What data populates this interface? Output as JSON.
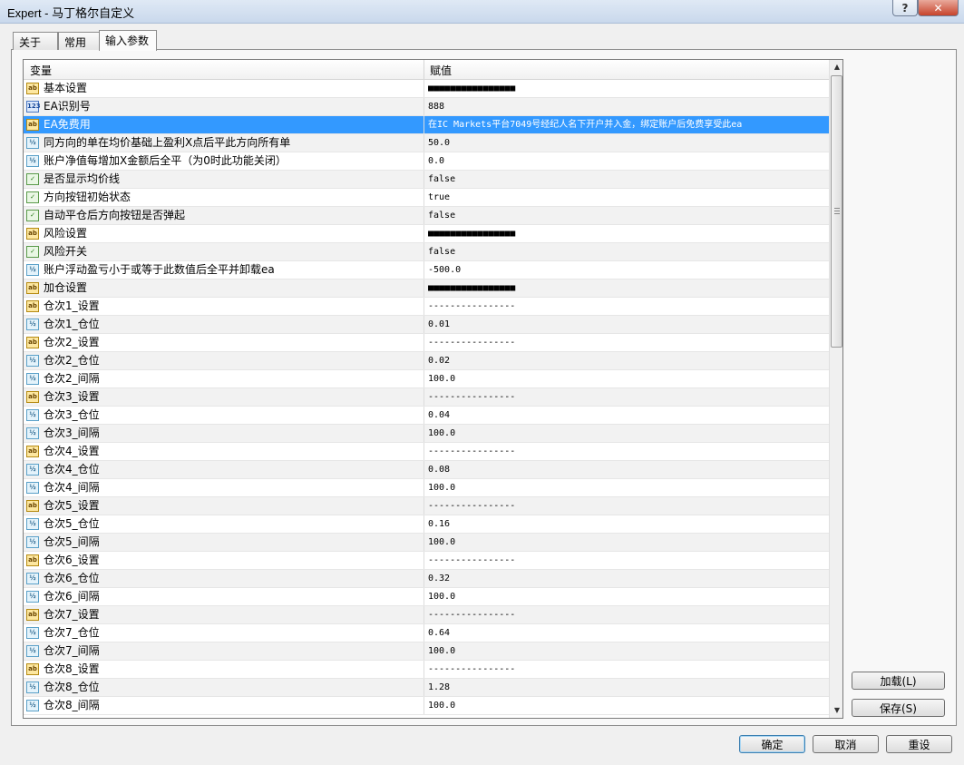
{
  "window": {
    "title": "Expert - 马丁格尔自定义",
    "help_label": "?",
    "close_label": "✕"
  },
  "tabs": [
    {
      "label": "关于"
    },
    {
      "label": "常用"
    },
    {
      "label": "输入参数"
    }
  ],
  "grid": {
    "col_variable": "变量",
    "col_value": "赋值",
    "rows": [
      {
        "type": "ab",
        "icon": "ab",
        "name": "基本设置",
        "value": "■■■■■■■■■■■■■■■■"
      },
      {
        "type": "num",
        "icon": "123",
        "name": "EA识别号",
        "value": "888"
      },
      {
        "type": "ab",
        "icon": "ab",
        "name": "EA免费用",
        "value": "在IC Markets平台7049号经纪人名下开户并入金，绑定账户后免费享受此ea",
        "selected": true
      },
      {
        "type": "dbl",
        "icon": "½",
        "name": "同方向的单在均价基础上盈利X点后平此方向所有单",
        "value": "50.0"
      },
      {
        "type": "dbl",
        "icon": "½",
        "name": "账户净值每增加X金额后全平（为0时此功能关闭）",
        "value": "0.0"
      },
      {
        "type": "bool",
        "icon": "✓",
        "name": "是否显示均价线",
        "value": "false"
      },
      {
        "type": "bool",
        "icon": "✓",
        "name": "方向按钮初始状态",
        "value": "true"
      },
      {
        "type": "bool",
        "icon": "✓",
        "name": "自动平仓后方向按钮是否弹起",
        "value": "false"
      },
      {
        "type": "ab",
        "icon": "ab",
        "name": "风险设置",
        "value": "■■■■■■■■■■■■■■■■"
      },
      {
        "type": "bool",
        "icon": "✓",
        "name": "风险开关",
        "value": "false"
      },
      {
        "type": "dbl",
        "icon": "½",
        "name": "账户浮动盈亏小于或等于此数值后全平并卸载ea",
        "value": "-500.0"
      },
      {
        "type": "ab",
        "icon": "ab",
        "name": "加仓设置",
        "value": "■■■■■■■■■■■■■■■■"
      },
      {
        "type": "ab",
        "icon": "ab",
        "name": "仓次1_设置",
        "value": "----------------"
      },
      {
        "type": "dbl",
        "icon": "½",
        "name": "仓次1_仓位",
        "value": "0.01"
      },
      {
        "type": "ab",
        "icon": "ab",
        "name": "仓次2_设置",
        "value": "----------------"
      },
      {
        "type": "dbl",
        "icon": "½",
        "name": "仓次2_仓位",
        "value": "0.02"
      },
      {
        "type": "dbl",
        "icon": "½",
        "name": "仓次2_间隔",
        "value": "100.0"
      },
      {
        "type": "ab",
        "icon": "ab",
        "name": "仓次3_设置",
        "value": "----------------"
      },
      {
        "type": "dbl",
        "icon": "½",
        "name": "仓次3_仓位",
        "value": "0.04"
      },
      {
        "type": "dbl",
        "icon": "½",
        "name": "仓次3_间隔",
        "value": "100.0"
      },
      {
        "type": "ab",
        "icon": "ab",
        "name": "仓次4_设置",
        "value": "----------------"
      },
      {
        "type": "dbl",
        "icon": "½",
        "name": "仓次4_仓位",
        "value": "0.08"
      },
      {
        "type": "dbl",
        "icon": "½",
        "name": "仓次4_间隔",
        "value": "100.0"
      },
      {
        "type": "ab",
        "icon": "ab",
        "name": "仓次5_设置",
        "value": "----------------"
      },
      {
        "type": "dbl",
        "icon": "½",
        "name": "仓次5_仓位",
        "value": "0.16"
      },
      {
        "type": "dbl",
        "icon": "½",
        "name": "仓次5_间隔",
        "value": "100.0"
      },
      {
        "type": "ab",
        "icon": "ab",
        "name": "仓次6_设置",
        "value": "----------------"
      },
      {
        "type": "dbl",
        "icon": "½",
        "name": "仓次6_仓位",
        "value": "0.32"
      },
      {
        "type": "dbl",
        "icon": "½",
        "name": "仓次6_间隔",
        "value": "100.0"
      },
      {
        "type": "ab",
        "icon": "ab",
        "name": "仓次7_设置",
        "value": "----------------"
      },
      {
        "type": "dbl",
        "icon": "½",
        "name": "仓次7_仓位",
        "value": "0.64"
      },
      {
        "type": "dbl",
        "icon": "½",
        "name": "仓次7_间隔",
        "value": "100.0"
      },
      {
        "type": "ab",
        "icon": "ab",
        "name": "仓次8_设置",
        "value": "----------------"
      },
      {
        "type": "dbl",
        "icon": "½",
        "name": "仓次8_仓位",
        "value": "1.28"
      },
      {
        "type": "dbl",
        "icon": "½",
        "name": "仓次8_间隔",
        "value": "100.0"
      }
    ]
  },
  "scrollbar": {
    "up": "▲",
    "down": "▼"
  },
  "side_buttons": {
    "load": "加载(L)",
    "save": "保存(S)"
  },
  "footer_buttons": {
    "ok": "确定",
    "cancel": "取消",
    "reset": "重设"
  }
}
